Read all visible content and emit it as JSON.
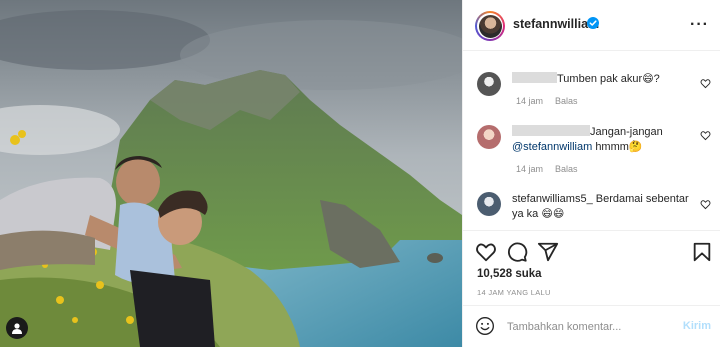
{
  "post": {
    "username": "stefannwilliam",
    "verified": true,
    "more_icon": "more-horizontal-icon"
  },
  "comments": [
    {
      "avatar_color": "#8a8a8a",
      "text": "Tumben pak akur😄?",
      "time": "14 jam",
      "reply": "Balas"
    },
    {
      "avatar_color": "#c77a7a",
      "text": "Jangan-jangan",
      "mention": "@stefannwilliam",
      "text_after": "hmmm🤔",
      "time": "14 jam",
      "reply": "Balas"
    },
    {
      "avatar_color": "#5a6b7a",
      "text": "stefanwilliams5_ Berdamai sebentar ya ka 😄😄"
    }
  ],
  "actions": {
    "like_icon": "heart-icon",
    "comment_icon": "comment-icon",
    "share_icon": "share-icon",
    "save_icon": "bookmark-icon"
  },
  "likes": "10,528 suka",
  "timestamp": "14 JAM YANG LALU",
  "add_comment": {
    "placeholder": "Tambahkan komentar...",
    "post_label": "Kirim",
    "emoji_icon": "smiley-icon"
  },
  "colors": {
    "accent": "#0095f6",
    "verified": "#0095f6",
    "post_disabled": "#b2dffc",
    "muted": "#8e8e8e"
  }
}
